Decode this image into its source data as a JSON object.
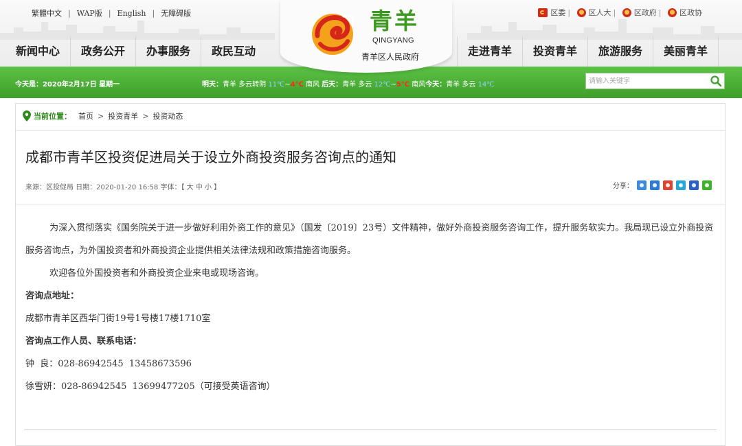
{
  "header": {
    "top_links": [
      "繁體中文",
      "WAP版",
      "English",
      "无障碍版"
    ],
    "gov_links": [
      "区委",
      "区人大",
      "区政府",
      "区政协"
    ],
    "logo": {
      "cn": "青羊",
      "en": "QINGYANG",
      "sub": "青羊区人民政府"
    },
    "nav_left": [
      "新闻中心",
      "政务公开",
      "办事服务",
      "政民互动"
    ],
    "nav_right": [
      "走进青羊",
      "投资青羊",
      "旅游服务",
      "美丽青羊"
    ]
  },
  "infobar": {
    "date": "今天是：2020年2月17日 星期一",
    "weather": {
      "today_label": "明天：",
      "today_desc": "青羊 多云转阴",
      "today_high": "11℃",
      "today_low": "4℃",
      "today_wind": "南风",
      "day2_label": "后天：",
      "day2_desc": "青羊 多云",
      "day2_high": "12℃",
      "day2_low": "5℃",
      "day2_wind": "南风",
      "day3_label": "今天：",
      "day3_desc": "青羊 多云",
      "day3_high": "14℃"
    },
    "search_placeholder": "请输入关键字"
  },
  "breadcrumb": {
    "label": "当前位置：",
    "items": [
      "首页",
      "投资青羊",
      "投资动态"
    ]
  },
  "article": {
    "title": "成都市青羊区投资促进局关于设立外商投资服务咨询点的通知",
    "meta": "来源：区投促局 日期：2020-01-20 16:58 字体：【 大 中 小 】",
    "share_label": "分享：",
    "para1": "为深入贯彻落实《国务院关于进一步做好利用外资工作的意见》（国发〔2019〕23号）文件精神，做好外商投资服务咨询工作，提升服务软实力。我局现已设立外商投资服务咨询点，为外国投资者和外商投资企业提供相关法律法规和政策措施咨询服务。",
    "para2": "欢迎各位外国投资者和外商投资企业来电或现场咨询。",
    "address_label": "咨询点地址：",
    "address": "成都市青羊区西华门街19号1号楼17楼1710室",
    "contact_label": "咨询点工作人员、联系电话：",
    "contact1": "钟  良：028-86942545  13458673596",
    "contact2": "徐雪妍：028-86942545  13699477205（可接受英语咨询）"
  },
  "colors": {
    "accent_green": "#3e9f2a",
    "logo_green": "#3c9a1e",
    "alert_red": "#ff2a12"
  }
}
